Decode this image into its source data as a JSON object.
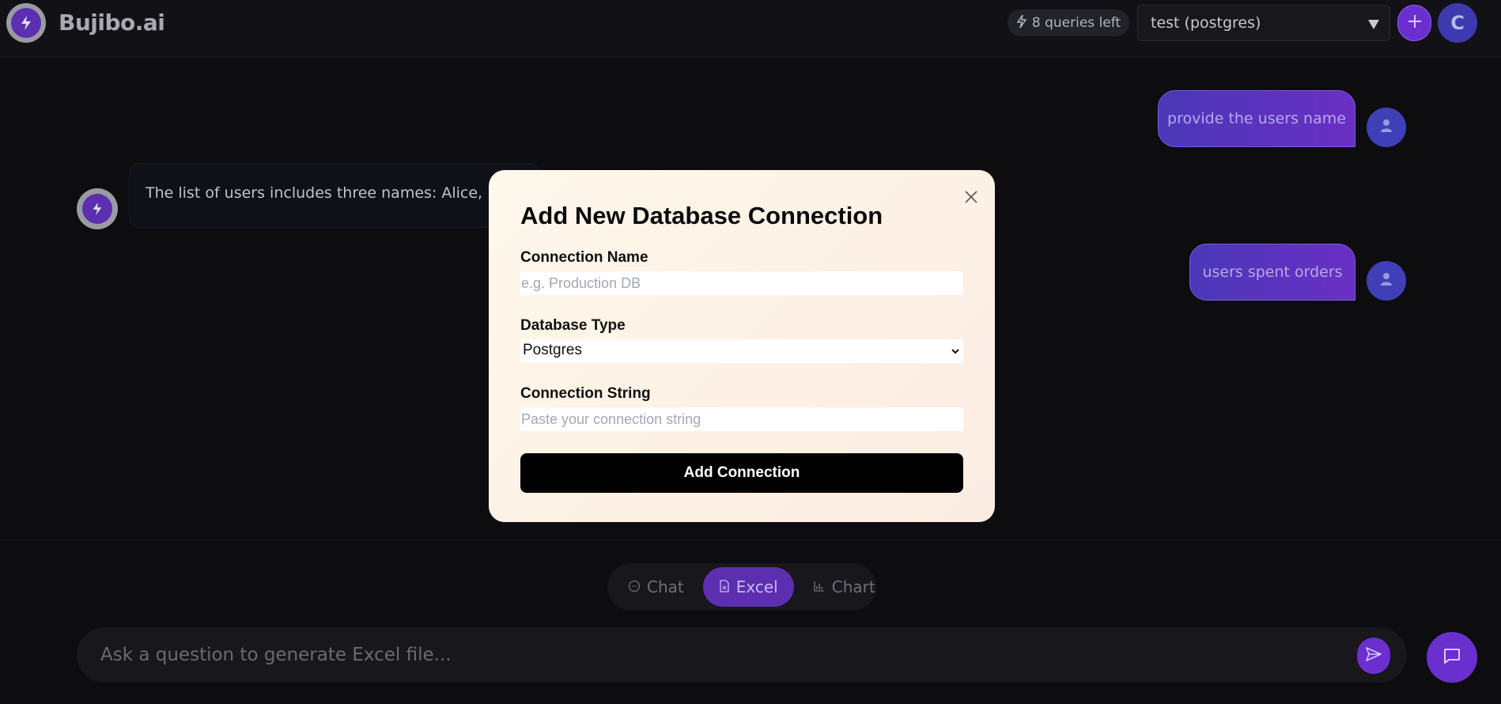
{
  "header": {
    "brand": "Bujibo.ai",
    "queries_left": "8 queries left",
    "db_selected": "test (postgres)",
    "avatar_initial": "C"
  },
  "messages": [
    {
      "role": "user",
      "text": "provide the users name"
    },
    {
      "role": "assistant",
      "text": "The list of users includes three names: Alice, Bob,"
    },
    {
      "role": "user",
      "text": "users spent orders"
    }
  ],
  "modes": {
    "tabs": [
      {
        "label": "Chat",
        "icon": "chat-bubble-icon"
      },
      {
        "label": "Excel",
        "icon": "file-icon"
      },
      {
        "label": "Chart",
        "icon": "bar-chart-icon"
      }
    ],
    "active": "Excel"
  },
  "composer": {
    "placeholder": "Ask a question to generate Excel file..."
  },
  "modal": {
    "title": "Add New Database Connection",
    "name_label": "Connection Name",
    "name_placeholder": "e.g. Production DB",
    "type_label": "Database Type",
    "type_value": "Postgres",
    "conn_label": "Connection String",
    "conn_placeholder": "Paste your connection string",
    "submit_label": "Add Connection"
  },
  "colors": {
    "accent": "#6b2fd0",
    "background": "#0d0d10",
    "modal_bg": "#fef6ea"
  }
}
